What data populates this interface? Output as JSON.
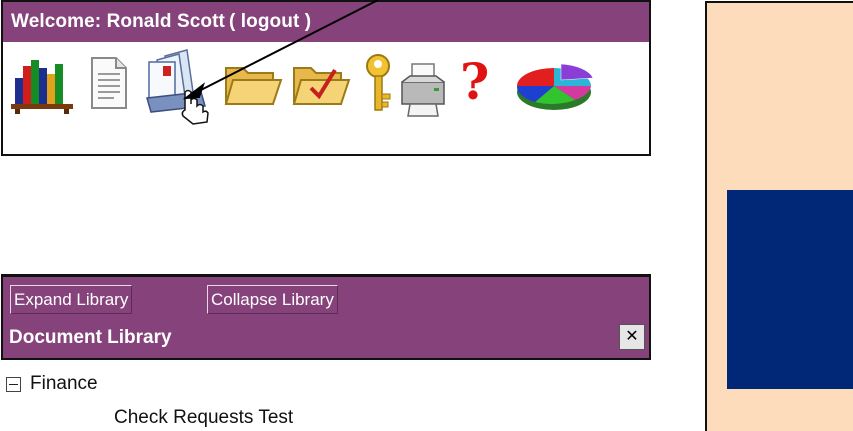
{
  "header": {
    "welcome_prefix": "Welcome: Ronald Scott",
    "logout_label": "( logout )"
  },
  "toolbar": {
    "icons": [
      "library-bookshelf-icon",
      "document-icon",
      "document-library-icon",
      "open-folder-icon",
      "checked-folder-icon",
      "key-icon",
      "printer-icon",
      "help-question-icon",
      "pie-chart-icon"
    ]
  },
  "library": {
    "expand_label": "Expand Library",
    "collapse_label": "Collapse Library",
    "title": "Document Library",
    "close_symbol": "✕"
  },
  "tree": {
    "root_label": "Finance",
    "child_label": "Check Requests Test"
  },
  "colors": {
    "header_purple": "#86437b",
    "right_panel_peach": "#fddcbc",
    "right_block_navy": "#002877"
  }
}
